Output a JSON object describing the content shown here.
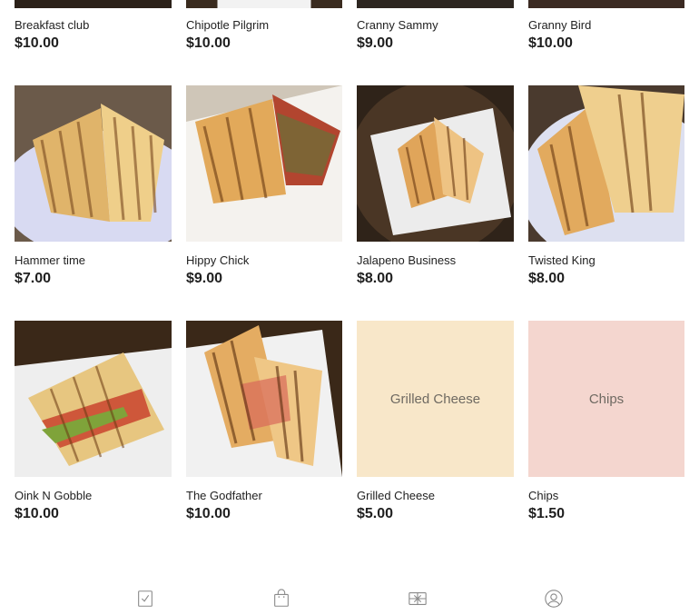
{
  "products": [
    {
      "name": "Breakfast club",
      "price": "$10.00",
      "image": "photo-dark",
      "placeholder": ""
    },
    {
      "name": "Chipotle Pilgrim",
      "price": "$10.00",
      "image": "photo-plate",
      "placeholder": ""
    },
    {
      "name": "Cranny Sammy",
      "price": "$9.00",
      "image": "photo-dark",
      "placeholder": ""
    },
    {
      "name": "Granny Bird",
      "price": "$10.00",
      "image": "photo-dark",
      "placeholder": ""
    },
    {
      "name": "Hammer time",
      "price": "$7.00",
      "image": "photo-blue-plate",
      "placeholder": ""
    },
    {
      "name": "Hippy Chick",
      "price": "$9.00",
      "image": "photo-white-plate",
      "placeholder": ""
    },
    {
      "name": "Jalapeno Business",
      "price": "$8.00",
      "image": "photo-wood",
      "placeholder": ""
    },
    {
      "name": "Twisted King",
      "price": "$8.00",
      "image": "photo-blue-plate",
      "placeholder": ""
    },
    {
      "name": "Oink N Gobble",
      "price": "$10.00",
      "image": "photo-wood",
      "placeholder": ""
    },
    {
      "name": "The Godfather",
      "price": "$10.00",
      "image": "photo-wood",
      "placeholder": ""
    },
    {
      "name": "Grilled Cheese",
      "price": "$5.00",
      "image": "placeholder",
      "placeholder": "Grilled Cheese",
      "color": "#f8e7c9"
    },
    {
      "name": "Chips",
      "price": "$1.50",
      "image": "placeholder",
      "placeholder": "Chips",
      "color": "#f4d6cf"
    }
  ],
  "bottom_nav": [
    {
      "icon": "checklist-icon"
    },
    {
      "icon": "shopping-bag-icon"
    },
    {
      "icon": "gift-card-icon"
    },
    {
      "icon": "user-icon"
    }
  ]
}
